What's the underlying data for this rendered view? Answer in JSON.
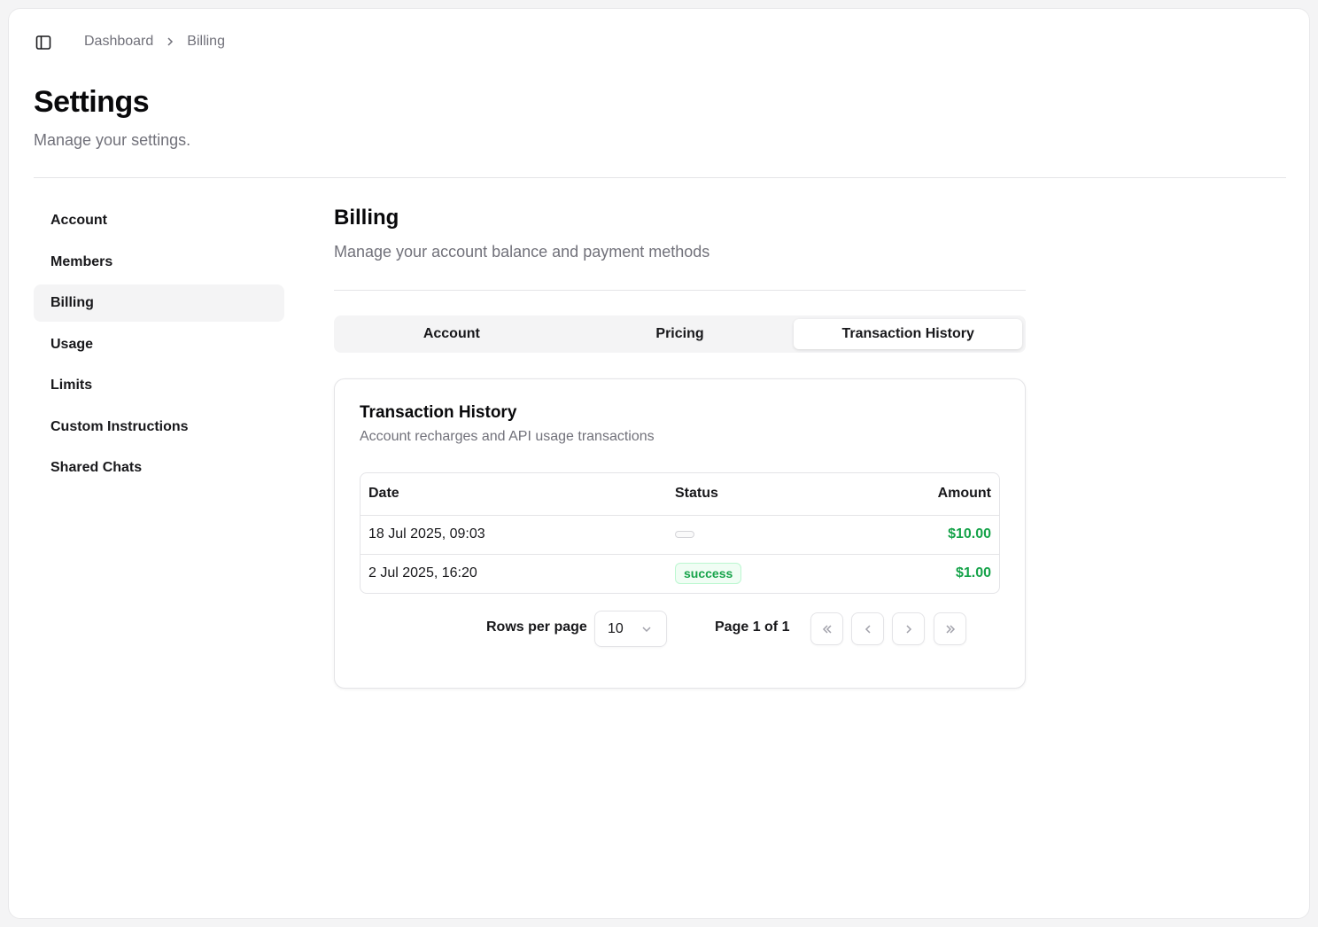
{
  "breadcrumb": {
    "items": [
      "Dashboard",
      "Billing"
    ]
  },
  "header": {
    "title": "Settings",
    "subtitle": "Manage your settings."
  },
  "nav": {
    "items": [
      "Account",
      "Members",
      "Billing",
      "Usage",
      "Limits",
      "Custom Instructions",
      "Shared Chats"
    ],
    "active": "Billing"
  },
  "section": {
    "title": "Billing",
    "subtitle": "Manage your account balance and payment methods"
  },
  "tabs": {
    "items": [
      "Account",
      "Pricing",
      "Transaction History"
    ],
    "active": "Transaction History"
  },
  "card": {
    "title": "Transaction History",
    "subtitle": "Account recharges and API usage transactions"
  },
  "table": {
    "headers": {
      "date": "Date",
      "status": "Status",
      "amount": "Amount"
    },
    "rows": [
      {
        "date": "18 Jul 2025, 09:03",
        "status": "",
        "amount": "$10.00"
      },
      {
        "date": "2 Jul 2025, 16:20",
        "status": "success",
        "amount": "$1.00"
      }
    ]
  },
  "pagination": {
    "rows_label": "Rows per page",
    "rows_value": "10",
    "page_info": "Page 1 of 1"
  },
  "icons": {
    "sidebar_toggle": "panel-left-icon",
    "breadcrumb_separator": "chevron-right-icon",
    "select": "chevron-down-icon",
    "first": "chevrons-left-icon",
    "prev": "chevron-left-icon",
    "next": "chevron-right-icon",
    "last": "chevrons-right-icon"
  },
  "colors": {
    "success": "#16a34a",
    "muted": "#71717a",
    "border": "#e4e4e7"
  }
}
